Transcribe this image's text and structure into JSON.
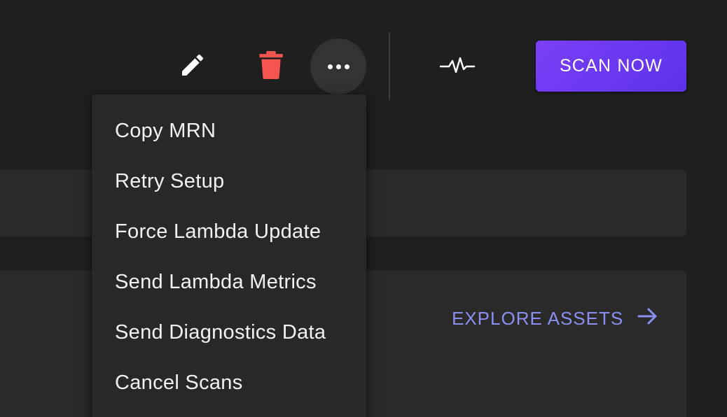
{
  "toolbar": {
    "edit_icon": "pencil-icon",
    "delete_icon": "trash-icon",
    "more_icon": "more-horizontal-icon",
    "activity_icon": "activity-pulse-icon",
    "scan_label": "SCAN NOW"
  },
  "main": {
    "explore_label": "EXPLORE ASSETS",
    "explore_icon": "arrow-right-icon"
  },
  "menu": {
    "items": [
      {
        "label": "Copy MRN"
      },
      {
        "label": "Retry Setup"
      },
      {
        "label": "Force Lambda Update"
      },
      {
        "label": "Send Lambda Metrics"
      },
      {
        "label": "Send Diagnostics Data"
      },
      {
        "label": "Cancel Scans"
      }
    ]
  },
  "colors": {
    "background": "#1f1f1f",
    "card": "#2a2a2a",
    "menu": "#282828",
    "accent_purple": "#7b3ff5",
    "link": "#8a8ff0",
    "delete_red": "#f5544f"
  }
}
